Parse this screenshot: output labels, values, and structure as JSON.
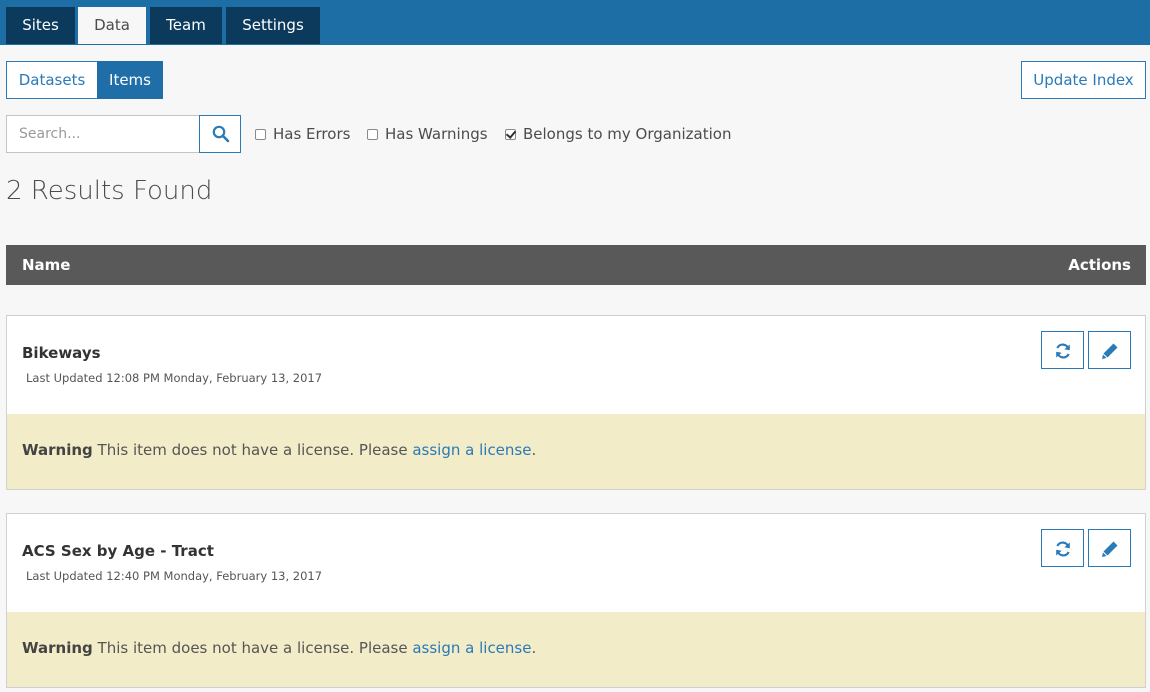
{
  "nav": {
    "tabs": [
      {
        "label": "Sites"
      },
      {
        "label": "Data"
      },
      {
        "label": "Team"
      },
      {
        "label": "Settings"
      }
    ],
    "active": "Data"
  },
  "toolbar": {
    "segments": [
      {
        "label": "Datasets"
      },
      {
        "label": "Items"
      }
    ],
    "update_index_label": "Update Index"
  },
  "filters": {
    "search_placeholder": "Search...",
    "search_value": "",
    "has_errors": {
      "label": "Has Errors",
      "checked": false
    },
    "has_warnings": {
      "label": "Has Warnings",
      "checked": false
    },
    "belongs_org": {
      "label": "Belongs to my Organization",
      "checked": true
    }
  },
  "results_text": "2 Results Found",
  "table": {
    "columns": {
      "name": "Name",
      "actions": "Actions"
    },
    "items": [
      {
        "name": "Bikeways",
        "last_updated": "Last Updated 12:08 PM Monday, February 13, 2017",
        "warning_label": "Warning",
        "warning_text": " This item does not have a license. Please ",
        "warning_link": "assign a license",
        "warning_end": "."
      },
      {
        "name": "ACS Sex by Age - Tract",
        "last_updated": "Last Updated 12:40 PM Monday, February 13, 2017",
        "warning_label": "Warning",
        "warning_text": " This item does not have a license. Please ",
        "warning_link": "assign a license",
        "warning_end": "."
      }
    ]
  },
  "icons": {
    "search": "search-icon",
    "refresh": "refresh-icon",
    "edit": "pencil-icon"
  },
  "colors": {
    "brand": "#1e6ea6",
    "nav_dark": "#0b3a5c",
    "accent": "#2a7ab8",
    "table_header": "#595959",
    "warning_bg": "#f2ecc8"
  }
}
